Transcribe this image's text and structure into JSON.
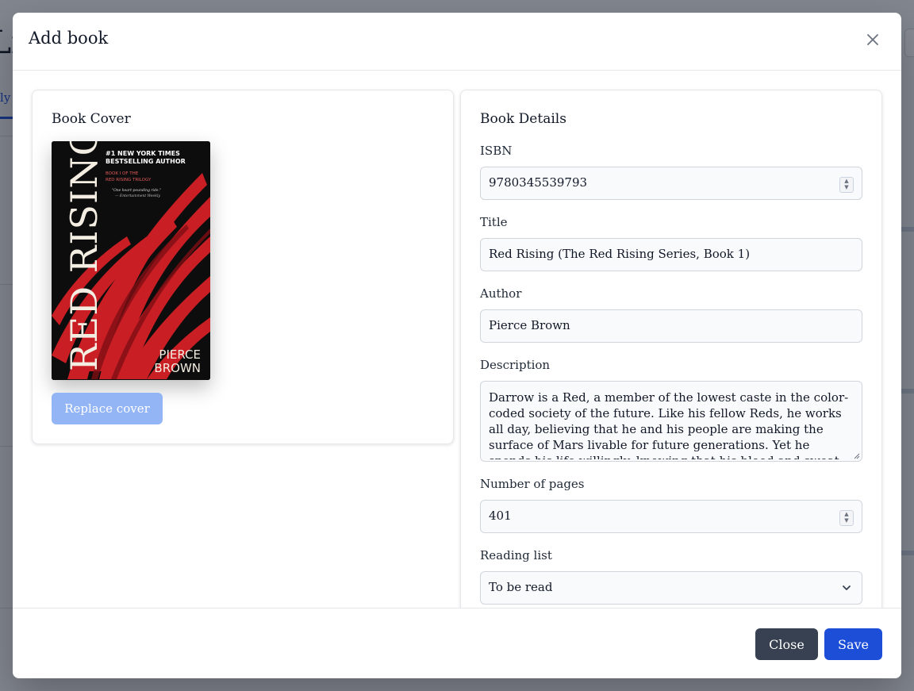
{
  "background": {
    "title_fragment": "Li",
    "tab_fragment": "tly"
  },
  "modal": {
    "title": "Add book",
    "cover_card": {
      "title": "Book Cover",
      "replace_label": "Replace cover",
      "cover_art": {
        "tagline_1": "#1 NEW YORK TIMES",
        "tagline_2": "BESTSELLING AUTHOR",
        "series_1": "BOOK I OF THE",
        "series_2": "RED RISING TRILOGY",
        "quote_1": "\"One heart-pounding ride.\"",
        "quote_2": "— Entertainment Weekly",
        "title": "RED RISING",
        "author_1": "PIERCE",
        "author_2": "BROWN"
      }
    },
    "details_card": {
      "title": "Book Details",
      "isbn_label": "ISBN",
      "isbn_value": "9780345539793",
      "title_label": "Title",
      "title_value": "Red Rising (The Red Rising Series, Book 1)",
      "author_label": "Author",
      "author_value": "Pierce Brown",
      "description_label": "Description",
      "description_value": "Darrow is a Red, a member of the lowest caste in the color-coded society of the future. Like his fellow Reds, he works all day, believing that he and his people are making the surface of Mars livable for future generations. Yet he spends his life willingly, knowing that his blood and sweat will one day result",
      "pages_label": "Number of pages",
      "pages_value": "401",
      "reading_list_label": "Reading list",
      "reading_list_value": "To be read"
    },
    "footer": {
      "close_label": "Close",
      "save_label": "Save"
    }
  },
  "colors": {
    "primary": "#1d4ed8",
    "primary_disabled": "#93b4f5",
    "secondary": "#374151",
    "cover_red": "#c81e24"
  },
  "icons": {
    "close": "close-icon",
    "chevron": "chevron-down-icon",
    "spinner": "number-spinner-icon"
  }
}
